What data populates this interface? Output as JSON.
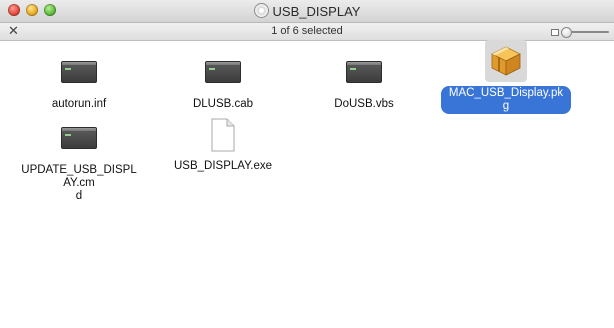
{
  "window": {
    "title": "USB_DISPLAY",
    "status": "1 of 6 selected"
  },
  "files": [
    {
      "name": "autorun.inf",
      "icon": "terminal-script-icon",
      "selected": false
    },
    {
      "name": "DLUSB.cab",
      "icon": "terminal-script-icon",
      "selected": false
    },
    {
      "name": "DoUSB.vbs",
      "icon": "terminal-script-icon",
      "selected": false
    },
    {
      "name": "MAC_USB_Display.pkg",
      "icon": "package-box-icon",
      "selected": true
    },
    {
      "name": "UPDATE_USB_DISPLAY.cm\nd",
      "icon": "terminal-script-icon",
      "selected": false
    },
    {
      "name": "USB_DISPLAY.exe",
      "icon": "blank-document-icon",
      "selected": false
    }
  ],
  "colors": {
    "selection": "#3875d7",
    "close": "#e0443a",
    "minimize": "#e6a91f",
    "zoom": "#58b73a"
  }
}
